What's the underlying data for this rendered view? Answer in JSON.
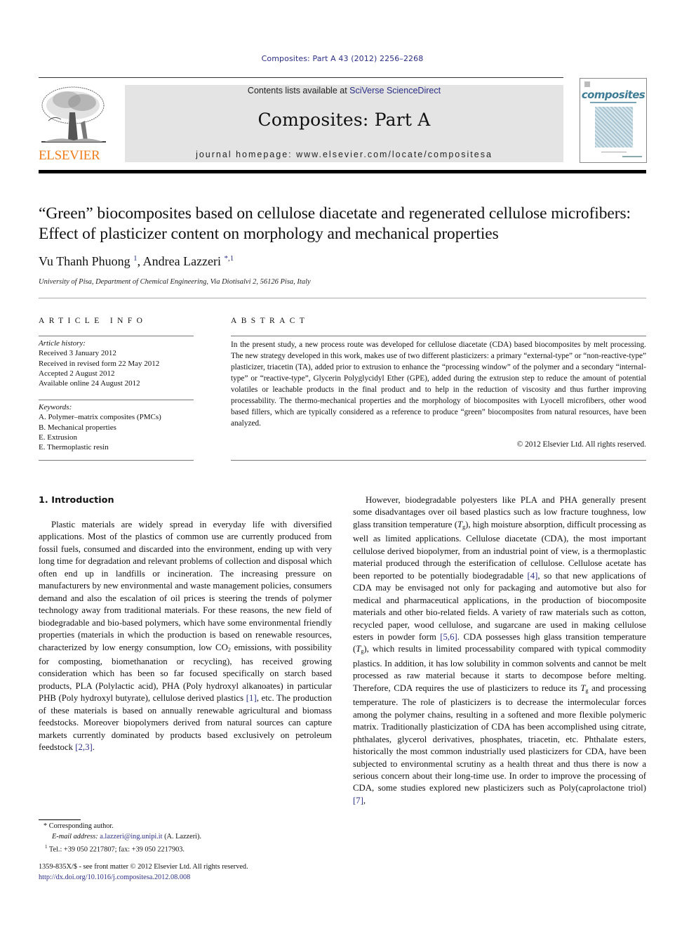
{
  "header": {
    "journal_ref": "Composites: Part A 43 (2012) 2256–2268",
    "contents_prefix": "Contents lists available at ",
    "contents_link": "SciVerse ScienceDirect",
    "journal_name": "Composites: Part A",
    "homepage": "journal homepage: www.elsevier.com/locate/compositesa",
    "publisher_logo_text": "ELSEVIER",
    "cover_title": "composites",
    "brand_color": "#f07d1b",
    "link_color": "#2b2f85"
  },
  "article": {
    "title": "“Green” biocomposites based on cellulose diacetate and regenerated cellulose microfibers: Effect of plasticizer content on morphology and mechanical properties",
    "authors": [
      {
        "name": "Vu Thanh Phuong",
        "marks": "1"
      },
      {
        "name": "Andrea Lazzeri",
        "marks": "*,1"
      }
    ],
    "author_separator": ", ",
    "affiliation": "University of Pisa, Department of Chemical Engineering, Via Diotisalvi 2, 56126 Pisa, Italy"
  },
  "article_info": {
    "heading": "ARTICLE INFO",
    "history_label": "Article history:",
    "history": [
      "Received 3 January 2012",
      "Received in revised form 22 May 2012",
      "Accepted 2 August 2012",
      "Available online 24 August 2012"
    ],
    "keywords_label": "Keywords:",
    "keywords": [
      "A. Polymer–matrix composites (PMCs)",
      "B. Mechanical properties",
      "E. Extrusion",
      "E. Thermoplastic resin"
    ]
  },
  "abstract": {
    "heading": "ABSTRACT",
    "text": "In the present study, a new process route was developed for cellulose diacetate (CDA) based biocomposites by melt processing. The new strategy developed in this work, makes use of two different plasticizers: a primary “external-type” or “non-reactive-type” plasticizer, triacetin (TA), added prior to extrusion to enhance the “processing window” of the polymer and a secondary “internal-type” or “reactive-type”, Glycerin Polyglycidyl Ether (GPE), added during the extrusion step to reduce the amount of potential volatiles or leachable products in the final product and to help in the reduction of viscosity and thus further improving processability. The thermo-mechanical properties and the morphology of biocomposites with Lyocell microfibers, other wood based fillers, which are typically considered as a reference to produce “green” biocomposites from natural resources, have been analyzed.",
    "copyright": "© 2012 Elsevier Ltd. All rights reserved."
  },
  "body": {
    "section_heading": "1. Introduction",
    "left_parts": [
      "Plastic materials are widely spread in everyday life with diversified applications. Most of the plastics of common use are currently produced from fossil fuels, consumed and discarded into the environment, ending up with very long time for degradation and relevant problems of collection and disposal which often end up in landfills or incineration. The increasing pressure on manufacturers by new environmental and waste management policies, consumers demand and also the escalation of oil prices is steering the trends of polymer technology away from traditional materials. For these reasons, the new field of biodegradable and bio-based polymers, which have some environmental friendly properties (materials in which the production is based on renewable resources, characterized by low energy consumption, low CO",
      "2",
      " emissions, with possibility for composting, biomethanation or recycling), has received growing consideration which has been so far focused specifically on starch based products, PLA (Polylactic acid), PHA (Poly hydroxyl alkanoates) in particular PHB (Poly hydroxyl butyrate), cellulose derived plastics ",
      "[1]",
      ", etc. The production of these materials is based on annually renewable agricultural and biomass feedstocks. Moreover biopolymers derived from natural sources can capture markets currently dominated by products based exclusively on petroleum feedstock ",
      "[2,3]",
      "."
    ],
    "right_parts": [
      "However, biodegradable polyesters like PLA and PHA generally present some disadvantages over oil based plastics such as low fracture toughness, low glass transition temperature (",
      "T",
      "g",
      "), high moisture absorption, difficult processing as well as limited applications. Cellulose diacetate (CDA), the most important cellulose derived biopolymer, from an industrial point of view, is a thermoplastic material produced through the esterification of cellulose. Cellulose acetate has been reported to be potentially biodegradable ",
      "[4]",
      ", so that new applications of CDA may be envisaged not only for packaging and automotive but also for medical and pharmaceutical applications, in the production of biocomposite materials and other bio-related fields. A variety of raw materials such as cotton, recycled paper, wood cellulose, and sugarcane are used in making cellulose esters in powder form ",
      "[5,6]",
      ". CDA possesses high glass transition temperature (",
      "T",
      "g",
      "), which results in limited processability compared with typical commodity plastics. In addition, it has low solubility in common solvents and cannot be melt processed as raw material because it starts to decompose before melting. Therefore, CDA requires the use of plasticizers to reduce its ",
      "T",
      "g",
      " and processing temperature. The role of plasticizers is to decrease the intermolecular forces among the polymer chains, resulting in a softened and more flexible polymeric matrix. Traditionally plasticization of CDA has been accomplished using citrate, phthalates, glycerol derivatives, phosphates, triacetin, etc. Phthalate esters, historically the most common industrially used plasticizers for CDA, have been subjected to environmental scrutiny as a health threat and thus there is now a serious concern about their long-time use. In order to improve the processing of CDA, some studies explored new plasticizers such as Poly(caprolactone triol) ",
      "[7]",
      ","
    ]
  },
  "footnotes": {
    "star_mark": "*",
    "corresponding": "Corresponding author.",
    "email_label": "E-mail address: ",
    "email": "a.lazzeri@ing.unipi.it",
    "email_suffix": " (A. Lazzeri).",
    "one_mark": "1",
    "tel": "Tel.: +39 050 2217807; fax: +39 050 2217903.",
    "front_matter": "1359-835X/$ - see front matter © 2012 Elsevier Ltd. All rights reserved.",
    "doi": "http://dx.doi.org/10.1016/j.compositesa.2012.08.008"
  }
}
